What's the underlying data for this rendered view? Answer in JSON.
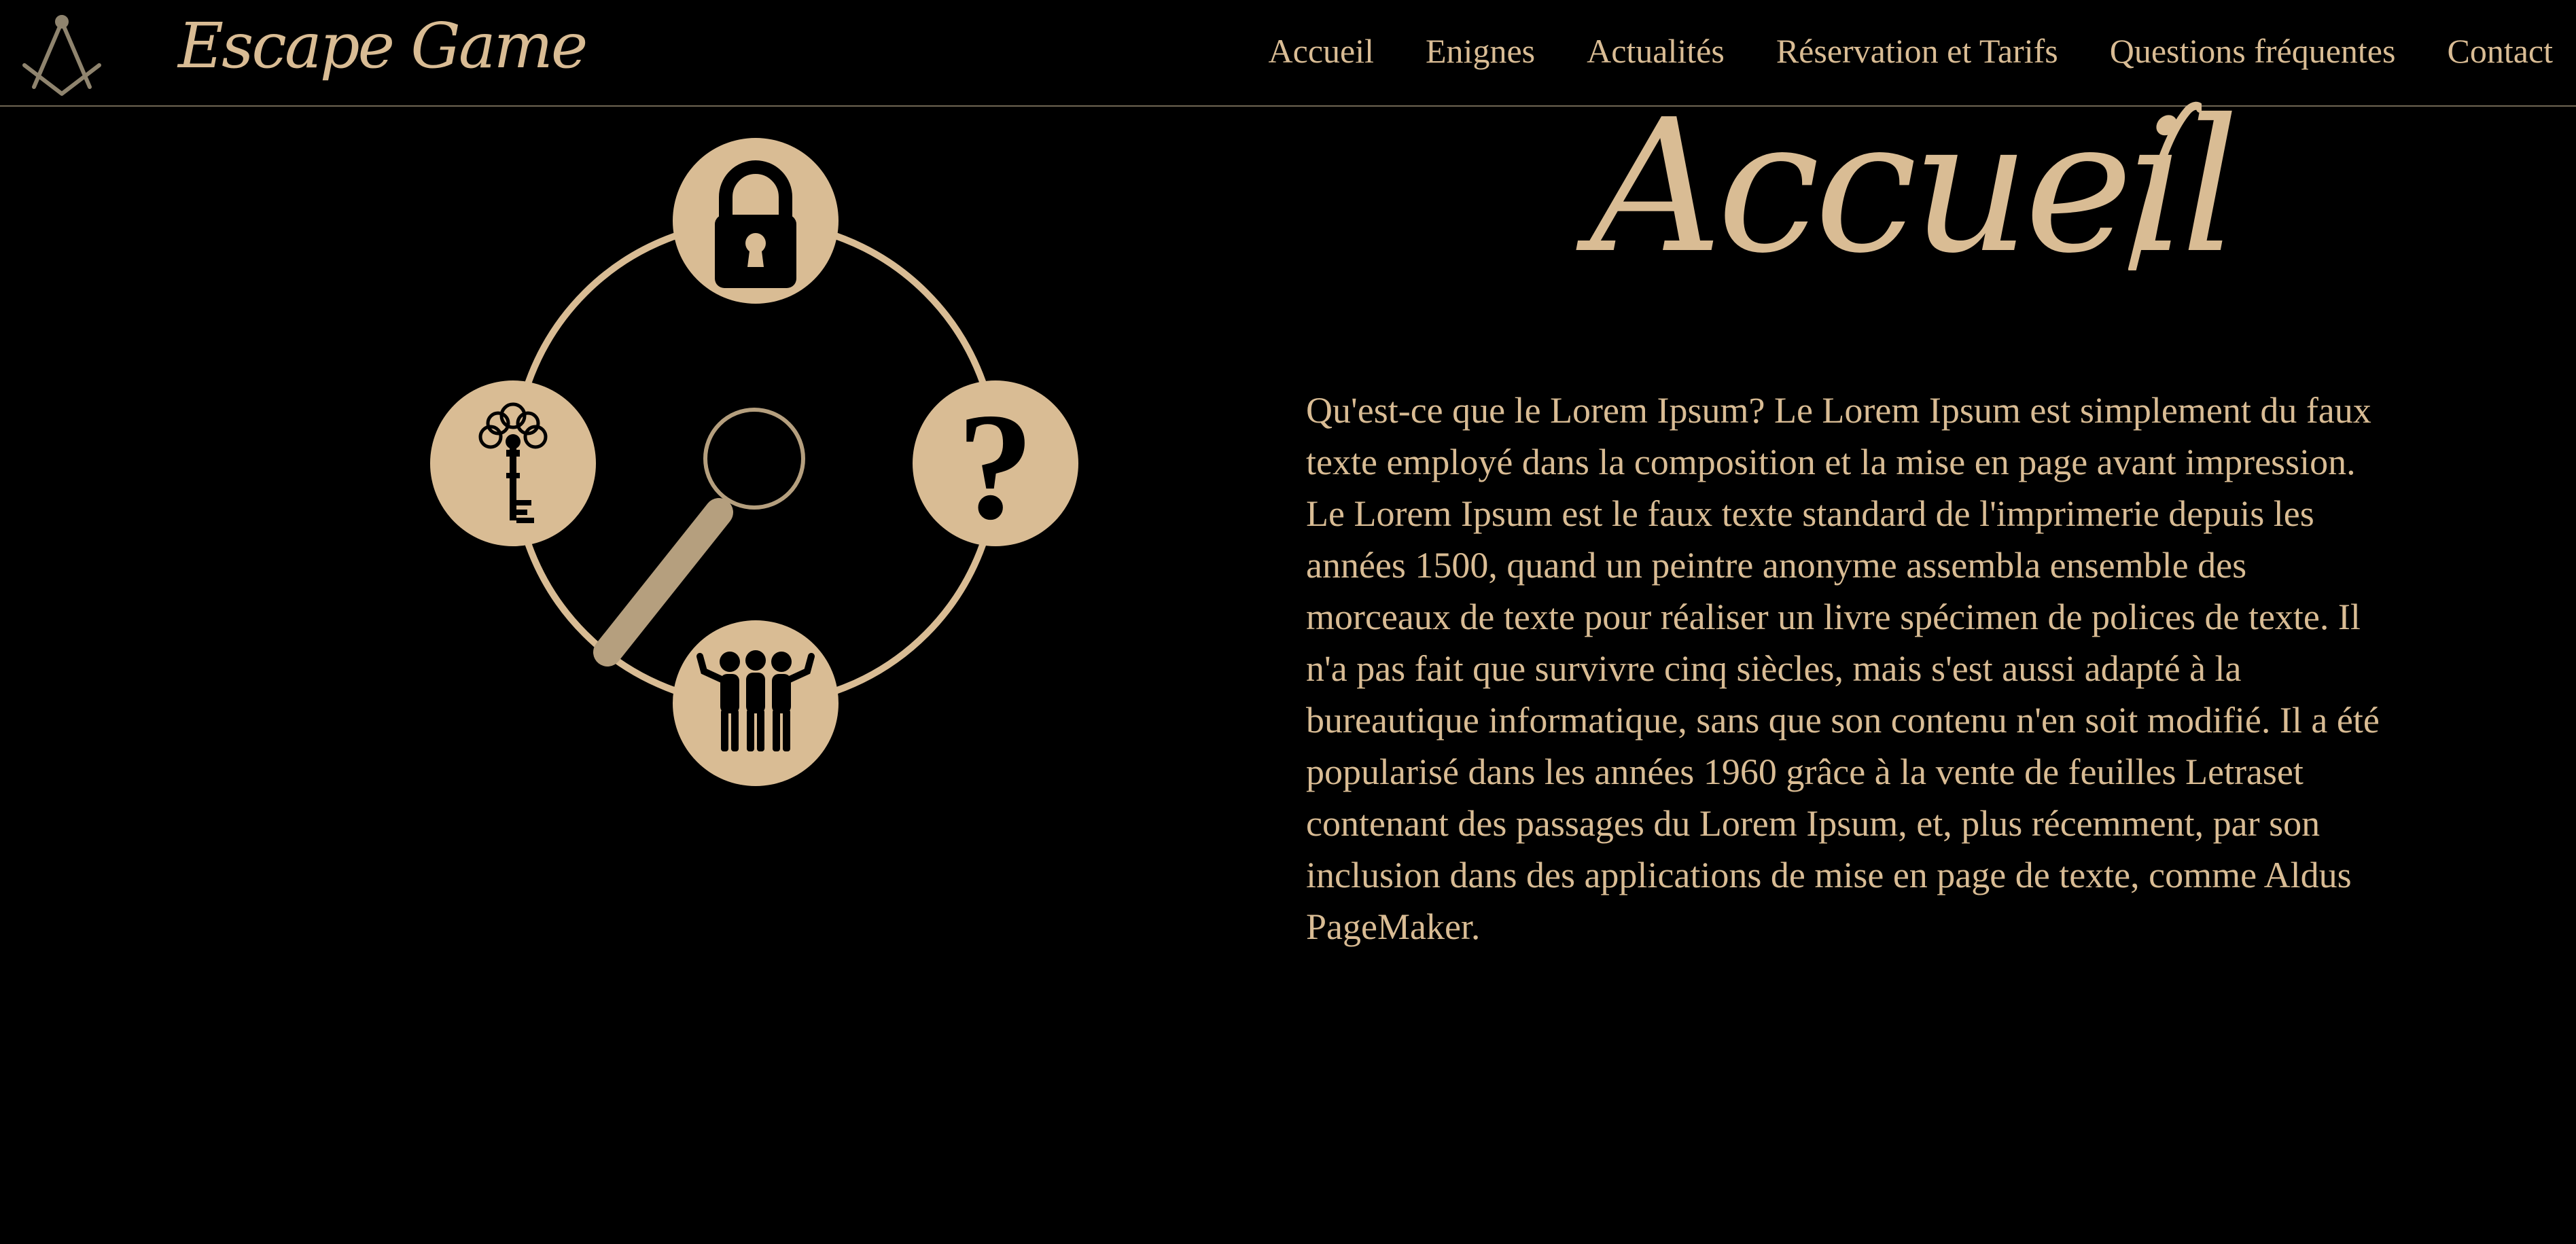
{
  "header": {
    "brand": "Escape Game",
    "logo_icon": "compass-square-icon",
    "nav": [
      {
        "label": "Accueil"
      },
      {
        "label": "Enignes"
      },
      {
        "label": "Actualités"
      },
      {
        "label": "Réservation et Tarifs"
      },
      {
        "label": "Questions fréquentes"
      },
      {
        "label": "Contact"
      }
    ]
  },
  "main": {
    "title": "Accueil",
    "paragraph": "Qu'est-ce que le Lorem Ipsum? Le Lorem Ipsum est simplement du faux texte employé dans la composition et la mise en page avant impression. Le Lorem Ipsum est le faux texte standard de l'imprimerie depuis les années 1500, quand un peintre anonyme assembla ensemble des morceaux de texte pour réaliser un livre spécimen de polices de texte. Il n'a pas fait que survivre cinq siècles, mais s'est aussi adapté à la bureautique informatique, sans que son contenu n'en soit modifié. Il a été popularisé dans les années 1960 grâce à la vente de feuilles Letraset contenant des passages du Lorem Ipsum, et, plus récemment, par son inclusion dans des applications de mise en page de texte, comme Aldus PageMaker.",
    "illustration": {
      "icons": [
        "padlock-icon",
        "question-mark-icon",
        "group-of-people-icon",
        "ornate-key-icon",
        "magnifying-glass-icon"
      ]
    }
  },
  "colors": {
    "background": "#000000",
    "accent": "#d9bc94",
    "divider": "#6f6553",
    "handle": "#b59f7e"
  }
}
